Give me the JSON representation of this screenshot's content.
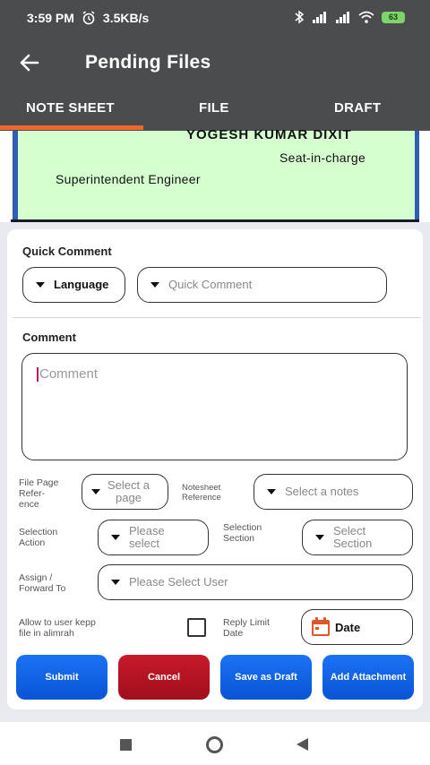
{
  "status_bar": {
    "time": "3:59 PM",
    "net_speed": "3.5KB/s",
    "battery": "63"
  },
  "app_bar": {
    "title": "Pending Files"
  },
  "tabs": [
    {
      "label": "NOTE SHEET"
    },
    {
      "label": "FILE"
    },
    {
      "label": "DRAFT"
    }
  ],
  "note_preview": {
    "name": "YOGESH KUMAR DIXIT",
    "role": "Seat-in-charge",
    "designation": "Superintendent Engineer"
  },
  "form": {
    "quick_comment_label": "Quick Comment",
    "language_dropdown": "Language",
    "quick_comment_placeholder": "Quick Comment",
    "comment_label": "Comment",
    "comment_placeholder": "Comment",
    "file_page_ref_label_1": "File Page",
    "file_page_ref_label_2": "Refer-",
    "file_page_ref_label_3": "ence",
    "select_page_1": "Select a",
    "select_page_2": "page",
    "notesheet_ref_label_1": "Notesheet",
    "notesheet_ref_label_2": "Reference",
    "select_notes": "Select a notes",
    "selection_action_label_1": "Selection",
    "selection_action_label_2": "Action",
    "please_select_1": "Please",
    "please_select_2": "select",
    "selection_section_label_1": "Selection",
    "selection_section_label_2": "Section",
    "select_section_1": "Select",
    "select_section_2": "Section",
    "assign_label_1": "Assign /",
    "assign_label_2": "Forward To",
    "select_user": "Please Select User",
    "allow_label_1": "Allow to user kepp",
    "allow_label_2": "file in alimrah",
    "reply_limit_label_1": "Reply Limit",
    "reply_limit_label_2": "Date",
    "date_button": "Date"
  },
  "actions": {
    "submit": "Submit",
    "cancel": "Cancel",
    "save_draft": "Save as Draft",
    "add_attachment": "Add Attachment"
  },
  "colors": {
    "header": "#4b4c4e",
    "tab_indicator": "#f2672b",
    "note_bg": "#d6ffd0",
    "primary_button": "#0a54d6",
    "cancel_button": "#a10e1c",
    "calendar_icon": "#e2552a"
  }
}
